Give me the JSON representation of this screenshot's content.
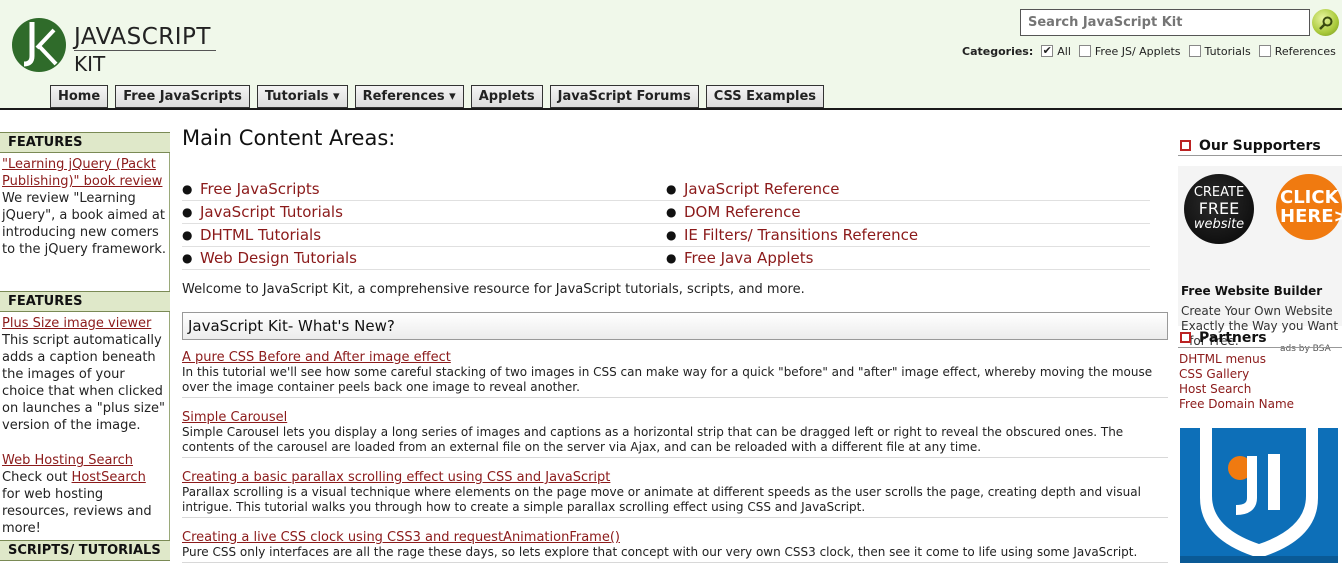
{
  "header": {
    "logo_line1": "JAVASCRIPT",
    "logo_line2": "KIT",
    "search_placeholder": "Search JavaScript Kit",
    "categories_label": "Categories:",
    "categories": [
      {
        "label": "All",
        "checked": true
      },
      {
        "label": "Free JS/ Applets",
        "checked": false
      },
      {
        "label": "Tutorials",
        "checked": false
      },
      {
        "label": "References",
        "checked": false
      }
    ]
  },
  "nav": [
    "Home",
    "Free JavaScripts",
    "Tutorials ▾",
    "References ▾",
    "Applets",
    "JavaScript Forums",
    "CSS Examples"
  ],
  "left": {
    "box1": {
      "heading": "FEATURES",
      "link": "\"Learning jQuery (Packt Publishing)\" book review",
      "text": "We review \"Learning jQuery\", a book aimed at introducing new comers to the jQuery framework."
    },
    "box2": {
      "heading": "FEATURES",
      "link1": "Plus Size image viewer",
      "text1": "This script automatically adds a caption beneath the images of your choice that when clicked on launches a \"plus size\" version of the image.",
      "link2": "Web Hosting Search",
      "text2_pre": "Check out ",
      "text2_link": "HostSearch",
      "text2_post": " for web hosting resources, reviews and more!"
    },
    "box3": {
      "heading": "SCRIPTS/ TUTORIALS"
    }
  },
  "main": {
    "title": "Main Content Areas:",
    "areas_left": [
      "Free JavaScripts",
      "JavaScript Tutorials",
      "DHTML Tutorials",
      "Web Design Tutorials"
    ],
    "areas_right": [
      "JavaScript Reference",
      "DOM Reference",
      "IE Filters/ Transitions Reference",
      "Free Java Applets"
    ],
    "welcome": "Welcome to JavaScript Kit, a comprehensive resource for JavaScript tutorials, scripts, and more.",
    "whats_new": "JavaScript Kit- What's New?",
    "news": [
      {
        "title": "A pure CSS Before and After image effect",
        "desc": "In this tutorial we'll see how some careful stacking of two images in CSS can make way for a quick \"before\" and \"after\" image effect, whereby moving the mouse over the image container peels back one image to reveal another."
      },
      {
        "title": "Simple Carousel",
        "desc": "Simple Carousel lets you display a long series of images and captions as a horizontal strip that can be dragged left or right to reveal the obscured ones. The contents of the carousel are loaded from an external file on the server via Ajax, and can be reloaded with a different file at any time."
      },
      {
        "title": "Creating a basic parallax scrolling effect using CSS and JavaScript",
        "desc": "Parallax scrolling is a visual technique where elements on the page move or animate at different speeds as the user scrolls the page, creating depth and visual intrigue. This tutorial walks you through how to create a simple parallax scrolling effect using CSS and JavaScript."
      },
      {
        "title": "Creating a live CSS clock using CSS3 and requestAnimationFrame()",
        "desc": "Pure CSS only interfaces are all the rage these days, so lets explore that concept with our very own CSS3 clock, then see it come to life using some JavaScript."
      }
    ]
  },
  "right": {
    "supporters_heading": "Our Supporters",
    "ad": {
      "badge_line1": "CREATE",
      "badge_line2": "FREE",
      "badge_line3": "website",
      "click_line1": "CLICK",
      "click_line2": "HERE>",
      "name": "Free Website Builder",
      "desc": "Create Your Own Website Exactly the Way you Want - for Free.",
      "ads_by": "ads by BSA"
    },
    "partners_heading": "Partners",
    "partners": [
      "DHTML menus",
      "CSS Gallery",
      "Host Search",
      "Free Domain Name"
    ]
  },
  "colors": {
    "link": "#8b1a1a",
    "header_bg": "#f0f8ea",
    "feature_head": "#dfe8c9",
    "logo_green": "#2f6b2a",
    "jetbrains_blue": "#0d6fb8"
  },
  "icons": {
    "search_button": "magnifier-icon",
    "supporters": "square-bullet-icon",
    "partners": "square-bullet-icon"
  }
}
